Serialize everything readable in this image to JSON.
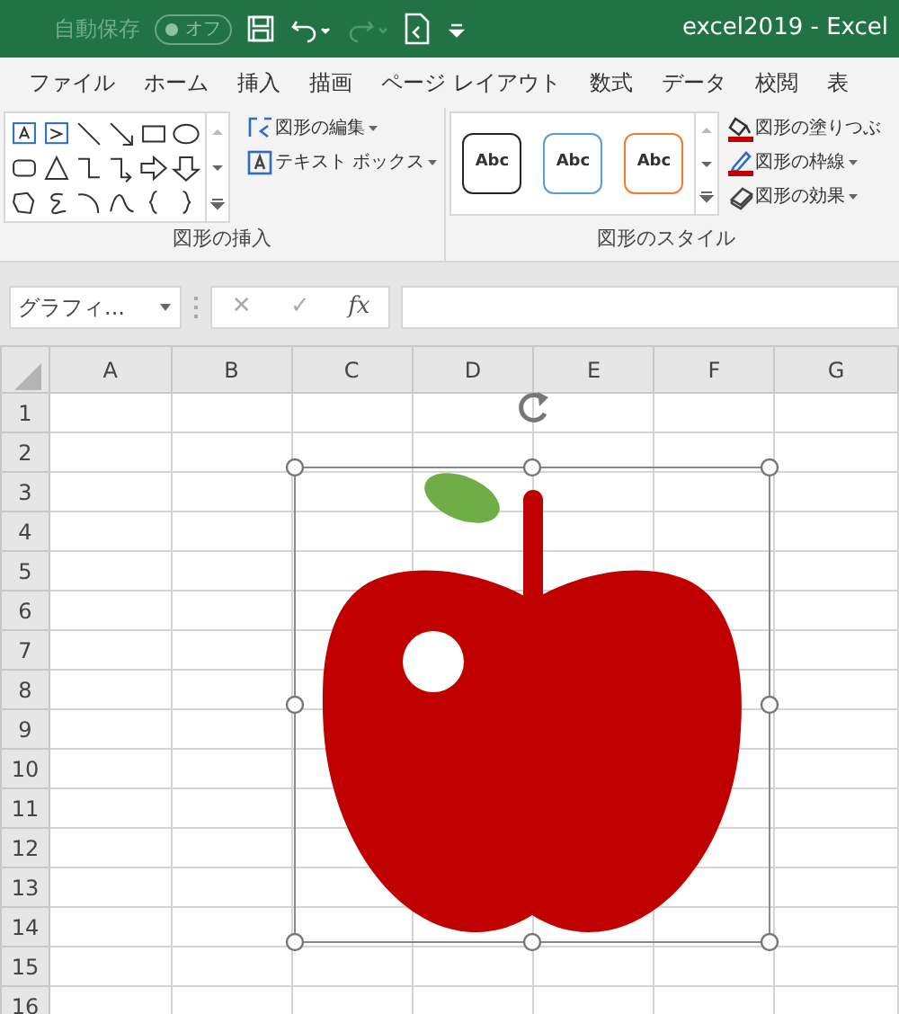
{
  "title_bar": {
    "autosave_label": "自動保存",
    "autosave_toggle": "オフ",
    "autosave_on": false,
    "title": "excel2019  -  Excel"
  },
  "menu_tabs": [
    {
      "label": "ファイル",
      "selected": false
    },
    {
      "label": "ホーム",
      "selected": false
    },
    {
      "label": "挿入",
      "selected": false
    },
    {
      "label": "描画",
      "selected": false
    },
    {
      "label": "ページ レイアウト",
      "selected": false
    },
    {
      "label": "数式",
      "selected": false
    },
    {
      "label": "データ",
      "selected": false
    },
    {
      "label": "校閲",
      "selected": false
    },
    {
      "label": "表",
      "selected": false
    }
  ],
  "ribbon": {
    "insert_group": {
      "label": "図形の挿入",
      "commands": [
        "図形の編集",
        "テキスト ボックス"
      ]
    },
    "style_group": {
      "label": "図形のスタイル",
      "styles": [
        {
          "label": "Abc",
          "color": "#262626"
        },
        {
          "label": "Abc",
          "color": "#5b9bd5"
        },
        {
          "label": "Abc",
          "color": "#ed7d31"
        }
      ],
      "commands": [
        {
          "label": "図形の塗りつぶ",
          "kind": "fill"
        },
        {
          "label": "図形の枠線",
          "kind": "outline"
        },
        {
          "label": "図形の効果",
          "kind": "effect"
        }
      ]
    }
  },
  "formula_bar": {
    "name_box": "グラフィ...",
    "cancel": "✕",
    "enter": "✓",
    "function": "fx"
  },
  "sheet": {
    "columns": [
      "A",
      "B",
      "C",
      "D",
      "E",
      "F",
      "G"
    ],
    "rows": [
      "1",
      "2",
      "3",
      "4",
      "5",
      "6",
      "7",
      "8",
      "9",
      "10",
      "11",
      "12",
      "13",
      "14",
      "15",
      "16"
    ],
    "shape": {
      "kind": "picture",
      "selected": true
    }
  }
}
